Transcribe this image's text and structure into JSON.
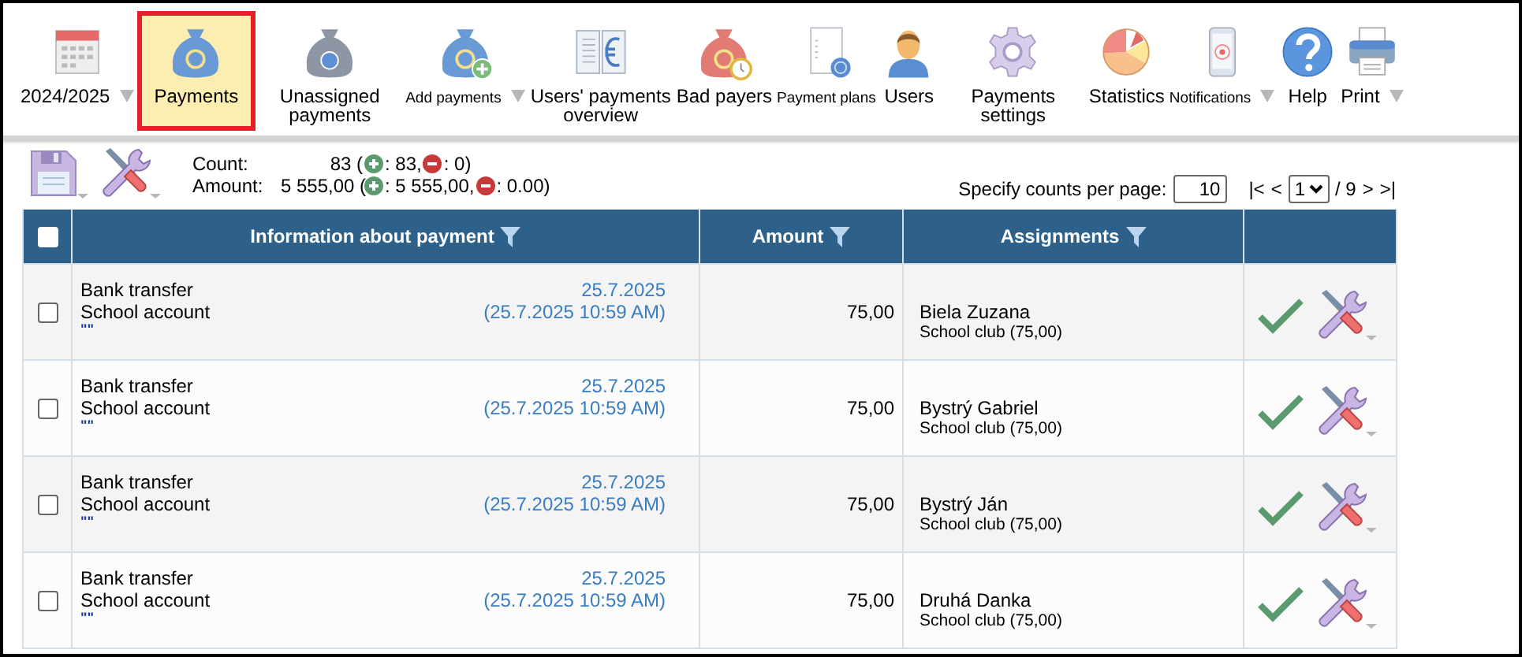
{
  "toolbar": [
    {
      "label": "2024/2025",
      "selected": false,
      "dropdown": true,
      "small_label": false
    },
    {
      "label": "Payments",
      "selected": true,
      "dropdown": false,
      "small_label": false
    },
    {
      "label": "Unassigned payments",
      "selected": false,
      "dropdown": false,
      "small_label": false
    },
    {
      "label": "Add payments",
      "selected": false,
      "dropdown": true,
      "small_label": true
    },
    {
      "label": "Users' payments overview",
      "selected": false,
      "dropdown": false,
      "small_label": false
    },
    {
      "label": "Bad payers",
      "selected": false,
      "dropdown": false,
      "small_label": false
    },
    {
      "label": "Payment plans",
      "selected": false,
      "dropdown": false,
      "small_label": true
    },
    {
      "label": "Users",
      "selected": false,
      "dropdown": false,
      "small_label": false
    },
    {
      "label": "Payments settings",
      "selected": false,
      "dropdown": false,
      "small_label": false
    },
    {
      "label": "Statistics",
      "selected": false,
      "dropdown": false,
      "small_label": false
    },
    {
      "label": "Notifications",
      "selected": false,
      "dropdown": true,
      "small_label": true
    },
    {
      "label": "Help",
      "selected": false,
      "dropdown": false,
      "small_label": false
    },
    {
      "label": "Print",
      "selected": false,
      "dropdown": true,
      "small_label": false
    }
  ],
  "summary": [
    {
      "label": "Count:",
      "value": "83 (",
      "plus": ": 83,",
      "minus": ": 0)"
    },
    {
      "label": "Amount:",
      "value": "5 555,00 (",
      "plus": ": 5 555,00,",
      "minus": ": 0.00)"
    }
  ],
  "pagination": {
    "label": "Specify counts per page:",
    "per_page": "10",
    "first": "|<",
    "prev": "<",
    "page": "1",
    "total": "/ 9",
    "next": ">",
    "last": ">|"
  },
  "table": {
    "select_all": {
      "checked": false
    },
    "columns": [
      {
        "label": "Information about payment"
      },
      {
        "label": "Amount"
      },
      {
        "label": "Assignments"
      }
    ],
    "rows": [
      {
        "checked": false,
        "method": "Bank transfer",
        "account": "School account",
        "note": "\"\"",
        "date": "25.7.2025",
        "datetime": "(25.7.2025 10:59 AM)",
        "amount": "75,00",
        "name": "Biela Zuzana",
        "assignment": "School club (75,00)"
      },
      {
        "checked": false,
        "method": "Bank transfer",
        "account": "School account",
        "note": "\"\"",
        "date": "25.7.2025",
        "datetime": "(25.7.2025 10:59 AM)",
        "amount": "75,00",
        "name": "Bystrý Gabriel",
        "assignment": "School club (75,00)"
      },
      {
        "checked": false,
        "method": "Bank transfer",
        "account": "School account",
        "note": "\"\"",
        "date": "25.7.2025",
        "datetime": "(25.7.2025 10:59 AM)",
        "amount": "75,00",
        "name": "Bystrý Ján",
        "assignment": "School club (75,00)"
      },
      {
        "checked": false,
        "method": "Bank transfer",
        "account": "School account",
        "note": "\"\"",
        "date": "25.7.2025",
        "datetime": "(25.7.2025 10:59 AM)",
        "amount": "75,00",
        "name": "Druhá Danka",
        "assignment": "School club (75,00)"
      }
    ]
  }
}
